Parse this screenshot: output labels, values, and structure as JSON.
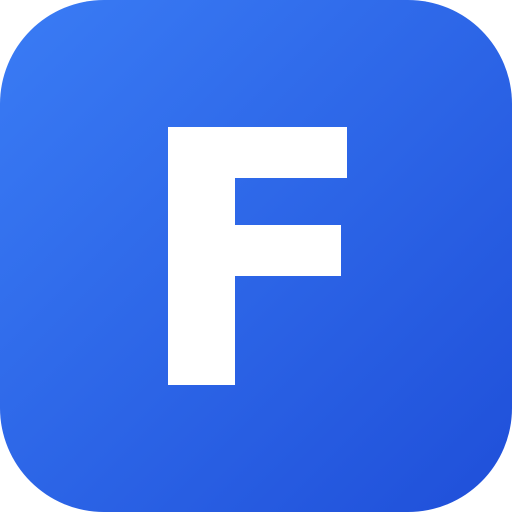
{
  "icon": {
    "letter": "F",
    "gradient_start": "#3a7cf5",
    "gradient_end": "#1f4fd9",
    "glyph_color": "#ffffff"
  }
}
